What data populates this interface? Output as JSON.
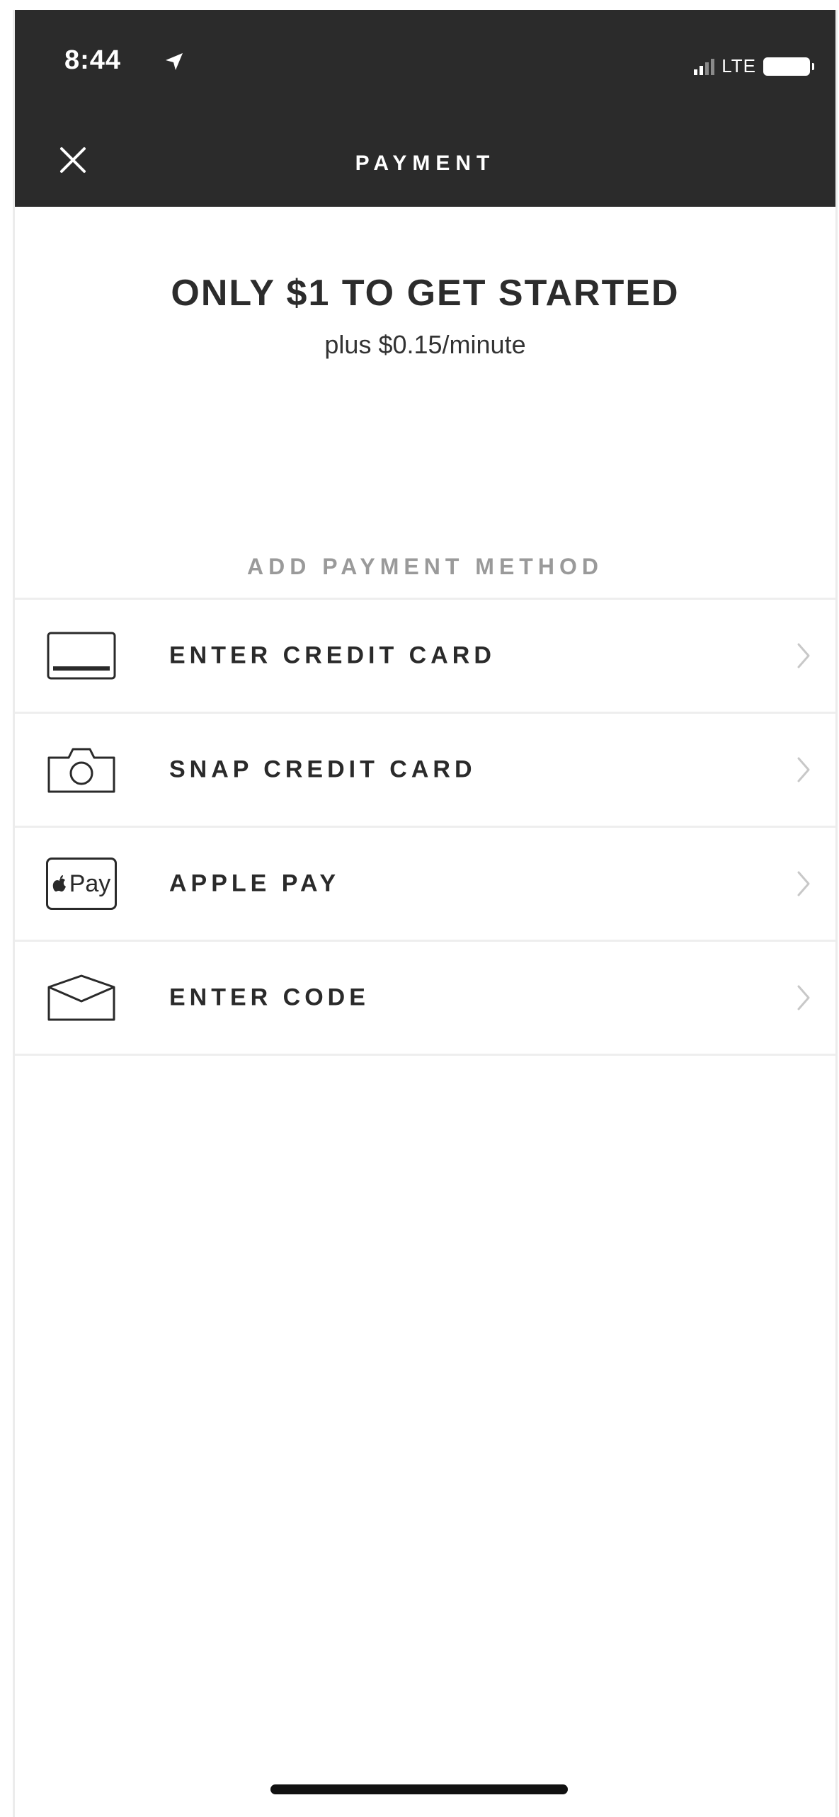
{
  "status_bar": {
    "time": "8:44",
    "network": "LTE"
  },
  "header": {
    "title": "PAYMENT",
    "close_icon": "close-icon"
  },
  "promo": {
    "headline": "ONLY $1 TO GET STARTED",
    "subheadline": "plus $0.15/minute"
  },
  "section": {
    "label": "ADD PAYMENT METHOD"
  },
  "payment_methods": [
    {
      "label": "ENTER CREDIT CARD",
      "icon": "credit-card-icon"
    },
    {
      "label": "SNAP CREDIT CARD",
      "icon": "camera-icon"
    },
    {
      "label": "APPLE PAY",
      "icon": "apple-pay-icon",
      "badge_text": "Pay"
    },
    {
      "label": "ENTER CODE",
      "icon": "envelope-icon"
    }
  ],
  "colors": {
    "header_bg": "#2b2b2b",
    "text_dark": "#2a2a2a",
    "section_label": "#9a9a9a",
    "divider": "#eeeeee",
    "chevron": "#c8c8c8"
  }
}
